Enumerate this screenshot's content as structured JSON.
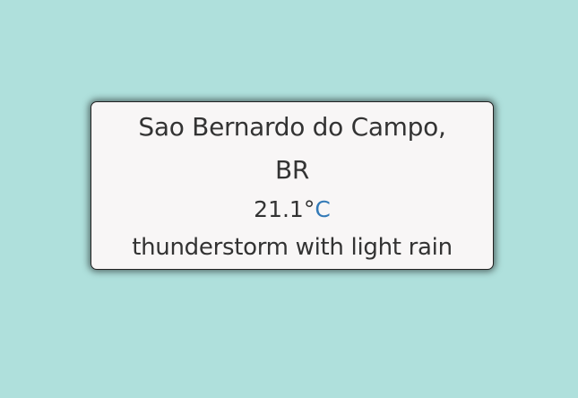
{
  "weather": {
    "city": "Sao Bernardo do Campo,",
    "country": "BR",
    "temperature": "21.1°",
    "unit": "C",
    "description": "thunderstorm with light rain"
  },
  "colors": {
    "background": "#afe0dc",
    "card": "#f8f6f6",
    "accent": "#337ab7"
  }
}
